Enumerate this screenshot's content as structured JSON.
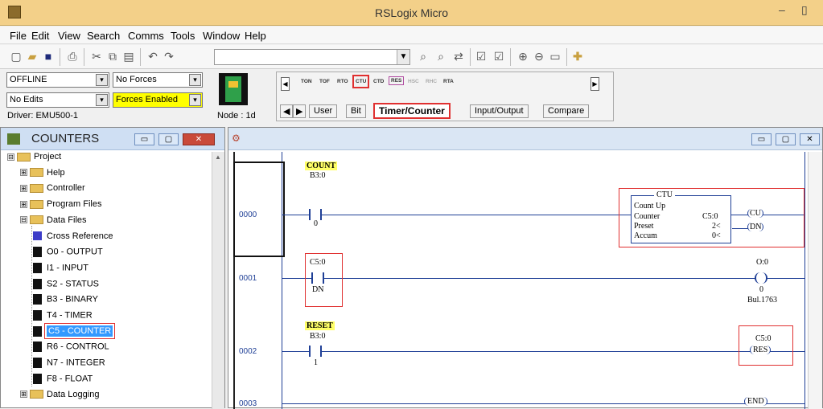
{
  "app": {
    "title": "RSLogix Micro"
  },
  "window_buttons": {
    "minimize": "–",
    "restore": "▯"
  },
  "menu": [
    "File",
    "Edit",
    "View",
    "Search",
    "Comms",
    "Tools",
    "Window",
    "Help"
  ],
  "status": {
    "mode": "OFFLINE",
    "forces": "No Forces",
    "edits": "No Edits",
    "forces_enabled": "Forces Enabled",
    "driver": "Driver: EMU500-1",
    "node": "Node : 1d"
  },
  "instructions": [
    "TON",
    "TOF",
    "RTO",
    "CTU",
    "CTD",
    "RES",
    "HSC",
    "RHC",
    "RTA"
  ],
  "tabs": [
    "User",
    "Bit",
    "Timer/Counter",
    "Input/Output",
    "Compare"
  ],
  "counters_window": {
    "title": "COUNTERS"
  },
  "tree": [
    {
      "label": "Project",
      "level": 0,
      "type": "folder",
      "expander": "⊟"
    },
    {
      "label": "Help",
      "level": 1,
      "type": "folder",
      "expander": "⊞"
    },
    {
      "label": "Controller",
      "level": 1,
      "type": "folder",
      "expander": "⊞"
    },
    {
      "label": "Program Files",
      "level": 1,
      "type": "folder",
      "expander": "⊞"
    },
    {
      "label": "Data Files",
      "level": 1,
      "type": "folder",
      "expander": "⊟"
    },
    {
      "label": "Cross Reference",
      "level": 2,
      "type": "xref"
    },
    {
      "label": "O0 - OUTPUT",
      "level": 2,
      "type": "file"
    },
    {
      "label": "I1 - INPUT",
      "level": 2,
      "type": "file"
    },
    {
      "label": "S2 - STATUS",
      "level": 2,
      "type": "file"
    },
    {
      "label": "B3 - BINARY",
      "level": 2,
      "type": "file"
    },
    {
      "label": "T4 - TIMER",
      "level": 2,
      "type": "file"
    },
    {
      "label": "C5 - COUNTER",
      "level": 2,
      "type": "file",
      "selected": true
    },
    {
      "label": "R6 - CONTROL",
      "level": 2,
      "type": "file"
    },
    {
      "label": "N7 - INTEGER",
      "level": 2,
      "type": "file"
    },
    {
      "label": "F8 - FLOAT",
      "level": 2,
      "type": "file"
    },
    {
      "label": "Data Logging",
      "level": 1,
      "type": "folder",
      "expander": "⊞"
    }
  ],
  "ladder": {
    "rungs": [
      "0000",
      "0001",
      "0002",
      "0003"
    ],
    "rung0": {
      "comment": "COUNT",
      "addr": "B3:0",
      "bit": "0",
      "ctu_title": "CTU",
      "ctu_name": "Count Up",
      "counter_label": "Counter",
      "counter_value": "C5:0",
      "preset_label": "Preset",
      "preset_value": "2<",
      "accum_label": "Accum",
      "accum_value": "0<",
      "coil_cu": "CU",
      "coil_dn": "DN"
    },
    "rung1": {
      "addr": "C5:0",
      "bit": "DN",
      "out_addr": "O:0",
      "out_bit": "0",
      "out_desc": "Bul.1763"
    },
    "rung2": {
      "comment": "RESET",
      "addr": "B3:0",
      "bit": "1",
      "res_addr": "C5:0",
      "res_label": "RES"
    },
    "rung3": {
      "end_label": "END"
    }
  },
  "colors": {
    "title_bar": "#f3d089",
    "highlight": "#e03030",
    "forces_enabled_bg": "#ffff00",
    "selected": "#3399ff",
    "rung_number": "#1f3f96"
  }
}
